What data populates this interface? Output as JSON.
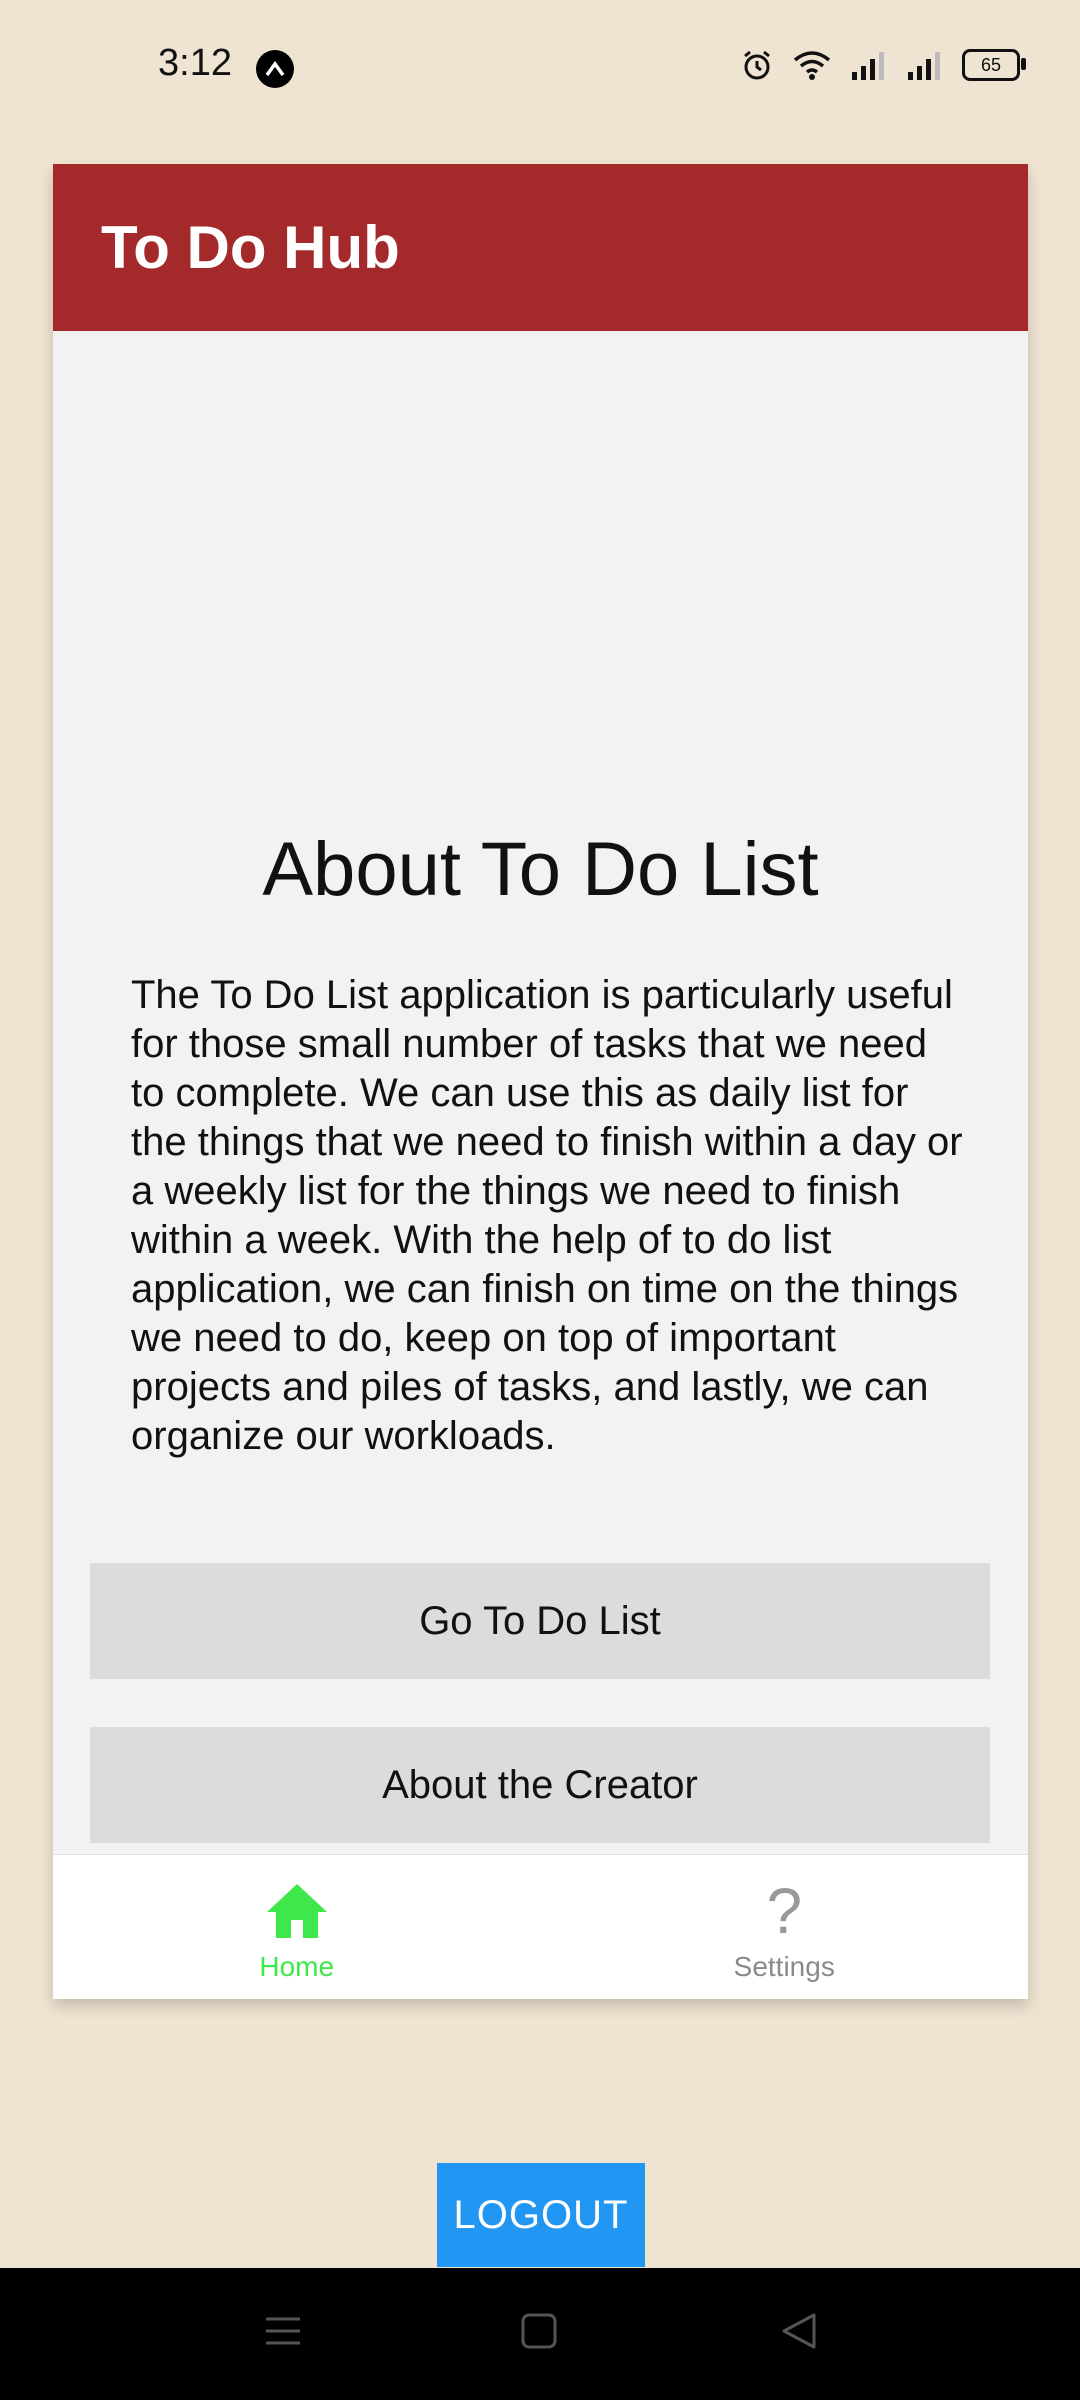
{
  "status_bar": {
    "time": "3:12",
    "app_badge_letter": "^",
    "battery": "65"
  },
  "app": {
    "title": "To Do Hub",
    "heading": "About To Do List",
    "description": "The To Do List application is particularly useful for those small number of tasks that we need to complete. We can use this as daily list for the things that we need to finish within a day or a weekly list for the things we need to finish within a week. With the help of to do list application, we can finish on time on the things we need to do, keep on top of important projects and piles of tasks, and lastly, we can organize our workloads.",
    "buttons": {
      "go_to_do_list": "Go To Do List",
      "about_creator": "About the Creator"
    },
    "tabs": [
      {
        "label": "Home",
        "icon": "home-icon",
        "active": true
      },
      {
        "label": "Settings",
        "icon": "question-mark-icon",
        "active": false
      }
    ]
  },
  "logout_label": "LOGOUT",
  "colors": {
    "app_bar": "#a3292b",
    "active_tab": "#3ee84a",
    "logout": "#2196f3",
    "background": "#efe3d1"
  }
}
